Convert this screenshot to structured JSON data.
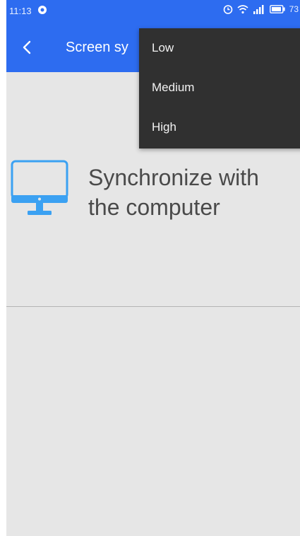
{
  "status_bar": {
    "time": "11:13",
    "battery": "73",
    "icons": [
      "notification-icon",
      "alarm-icon",
      "wifi-icon",
      "signal-icon",
      "battery-icon"
    ]
  },
  "app_bar": {
    "back_icon": "chevron-left-icon",
    "title": "Screen sy"
  },
  "main": {
    "sync_icon": "monitor-icon",
    "sync_label": "Synchronize with the computer"
  },
  "quality_menu": {
    "items": [
      {
        "label": "Low"
      },
      {
        "label": "Medium"
      },
      {
        "label": "High"
      }
    ]
  },
  "colors": {
    "primary": "#2d6cf0",
    "background": "#e6e6e6",
    "menu_background": "#303030",
    "monitor_icon": "#3ba1f2"
  }
}
